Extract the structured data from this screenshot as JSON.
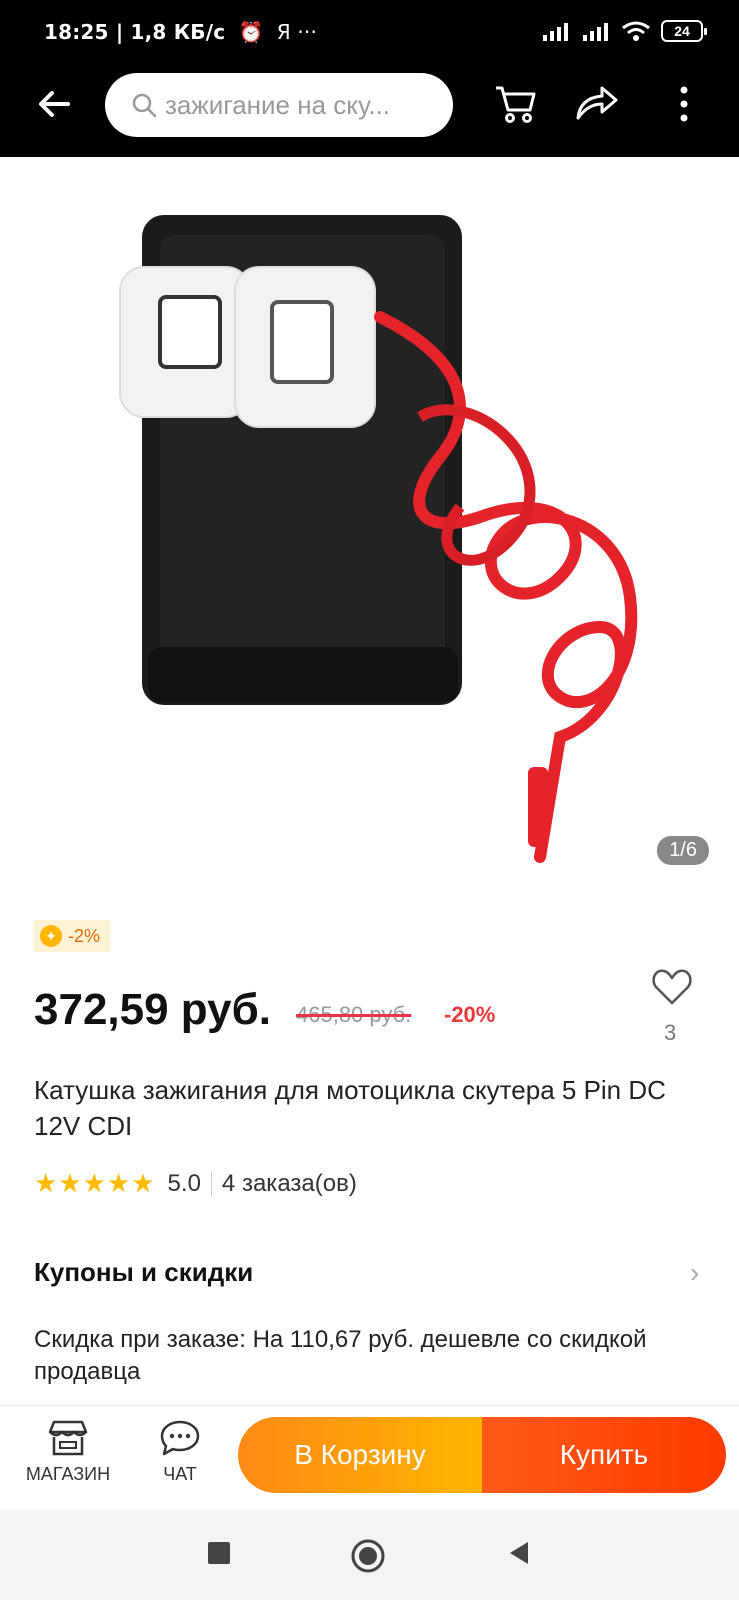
{
  "status_bar": {
    "time": "18:25",
    "speed": "1,8 КБ/с",
    "extra": "Я ···",
    "battery": "24"
  },
  "top_bar": {
    "search_placeholder": "зажигание на ску..."
  },
  "gallery": {
    "counter": "1/6"
  },
  "promo_badge": "-2%",
  "price": {
    "current": "372,59 руб.",
    "old": "465,80 руб.",
    "discount": "-20%"
  },
  "favorite": {
    "count": "3"
  },
  "product": {
    "title": "Катушка зажигания для мотоцикла скутера 5 Pin DC 12V CDI",
    "stars": "★★★★★",
    "rating": "5.0",
    "orders": "4 заказа(ов)"
  },
  "coupons": {
    "heading": "Купоны и скидки",
    "text": "Скидка при заказе: На 110,67 руб. дешевле со скидкой продавца"
  },
  "bottom_bar": {
    "shop_label": "МАГАЗИН",
    "chat_label": "ЧАТ",
    "cart_button": "В Корзину",
    "buy_button": "Купить"
  },
  "colors": {
    "accent_orange": "#ff8a17",
    "accent_red": "#ff3b00",
    "discount_red": "#e8393a",
    "star": "#ffbb00"
  }
}
